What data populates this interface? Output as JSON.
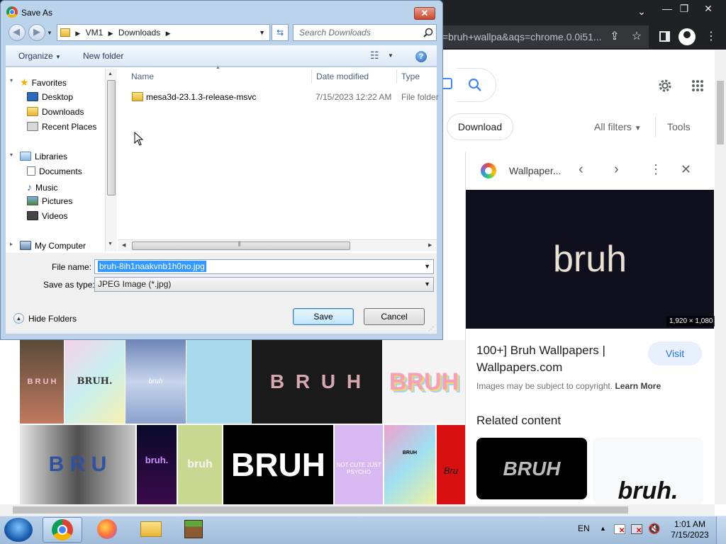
{
  "browser": {
    "omnibox_text": "=bruh+wallpa&aqs=chrome.0.0i51...",
    "window_controls": {
      "minimize": "—",
      "maximize": "❐",
      "close": "✕"
    },
    "chevron": "⌄"
  },
  "google": {
    "chips": {
      "download": "Download"
    },
    "all_filters": "All filters",
    "tools": "Tools",
    "thumb_texts": [
      "B R U H",
      "BRUH.",
      "bruh",
      "B R U H",
      "BRUH",
      "B R U",
      "bruh.",
      "bruh",
      "BRUH",
      "NOT CUTE JUST PSYCHO",
      "BRUH",
      "Bru"
    ]
  },
  "panel": {
    "source": "Wallpaper...",
    "preview_text": "bruh",
    "dimensions": "1,920 × 1,080",
    "title": "100+] Bruh Wallpapers | Wallpapers.com",
    "visit": "Visit",
    "copyright": "Images may be subject to copyright.",
    "learn_more": "Learn More",
    "related": "Related content",
    "related_thumb_1": "BRUH",
    "related_thumb_2": "bruh."
  },
  "dialog": {
    "title": "Save As",
    "breadcrumb": [
      "VM1",
      "Downloads"
    ],
    "search_placeholder": "Search Downloads",
    "organize": "Organize",
    "new_folder": "New folder",
    "favorites": "Favorites",
    "nav": {
      "desktop": "Desktop",
      "downloads": "Downloads",
      "recent_places": "Recent Places",
      "libraries": "Libraries",
      "documents": "Documents",
      "music": "Music",
      "pictures": "Pictures",
      "videos": "Videos",
      "my_computer": "My Computer"
    },
    "columns": {
      "name": "Name",
      "date_modified": "Date modified",
      "type": "Type"
    },
    "files": [
      {
        "name": "mesa3d-23.1.3-release-msvc",
        "date": "7/15/2023 12:22 AM",
        "type": "File folder"
      }
    ],
    "file_name_label": "File name:",
    "file_name_value": "bruh-8ih1naakvnb1h0no.jpg",
    "save_type_label": "Save as type:",
    "save_type_value": "JPEG Image (*.jpg)",
    "hide_folders": "Hide Folders",
    "save": "Save",
    "cancel": "Cancel"
  },
  "taskbar": {
    "lang": "EN",
    "time": "1:01 AM",
    "date": "7/15/2023"
  }
}
